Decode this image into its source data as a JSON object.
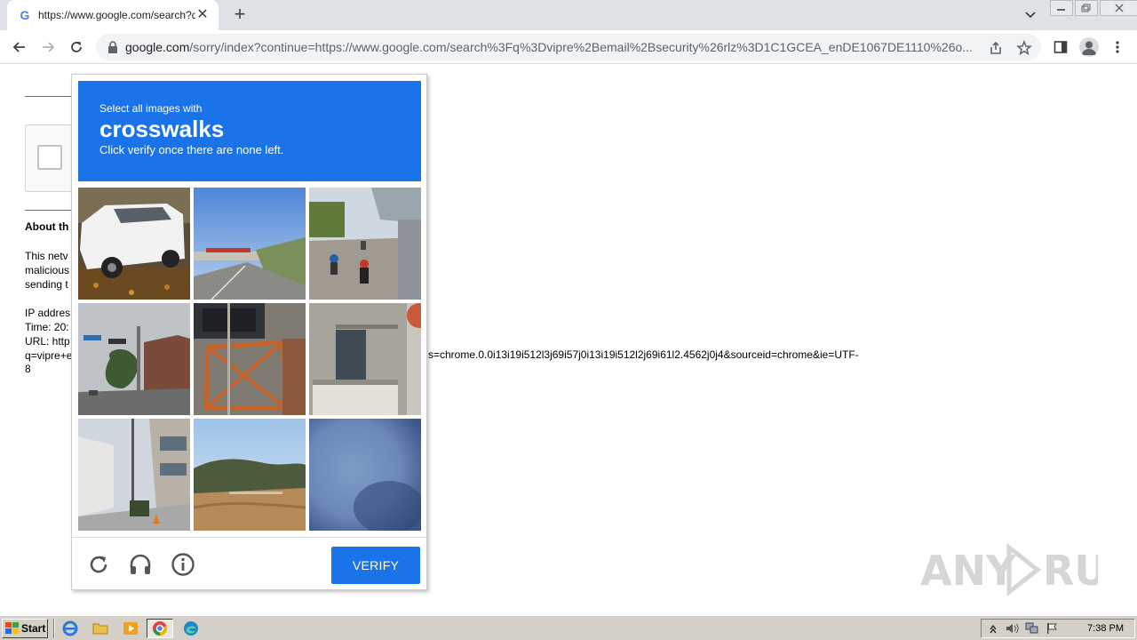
{
  "browser": {
    "tab_title": "https://www.google.com/search?q=",
    "tab_favicon": "G",
    "new_tab_glyph": "+",
    "close_glyph": "✕",
    "url_host": "google.com",
    "url_path": "/sorry/index?continue=https://www.google.com/search%3Fq%3Dvipre%2Bemail%2Bsecurity%26rlz%3D1C1GCEA_enDE1067DE1110%26o..."
  },
  "page": {
    "about_heading": "About th",
    "paragraph": "This netv\nmalicious\nsending t",
    "info_lines": "IP addres\nTime: 20:\nURL: http\nq=vipre+e",
    "url_tail": "s=chrome.0.0i13i19i512l3j69i57j0i13i19i512l2j69i61l2.4562j0j4&sourceid=chrome&ie=UTF-",
    "url_tail_2": "8"
  },
  "captcha": {
    "subtitle": "Select all images with",
    "target": "crosswalks",
    "instruction": "Click verify once there are none left.",
    "verify_label": "VERIFY",
    "tiles": [
      {
        "name": "tile-white-suv",
        "icon": "car-image"
      },
      {
        "name": "tile-highway-overpass",
        "icon": "bridge-image"
      },
      {
        "name": "tile-motorcycles-road",
        "icon": "motorcycle-image"
      },
      {
        "name": "tile-street-traffic-light",
        "icon": "traffic-light-image"
      },
      {
        "name": "tile-orange-fence",
        "icon": "fence-image"
      },
      {
        "name": "tile-building-wall",
        "icon": "building-image"
      },
      {
        "name": "tile-city-street",
        "icon": "street-image"
      },
      {
        "name": "tile-river-landscape",
        "icon": "landscape-image"
      },
      {
        "name": "tile-blurry-blue",
        "icon": "blur-image"
      }
    ]
  },
  "watermark": "ANY RUN",
  "taskbar": {
    "start_label": "Start",
    "clock": "7:38 PM"
  },
  "colors": {
    "captcha_blue": "#1a73e8",
    "taskbar_gray": "#d4d0c8"
  }
}
